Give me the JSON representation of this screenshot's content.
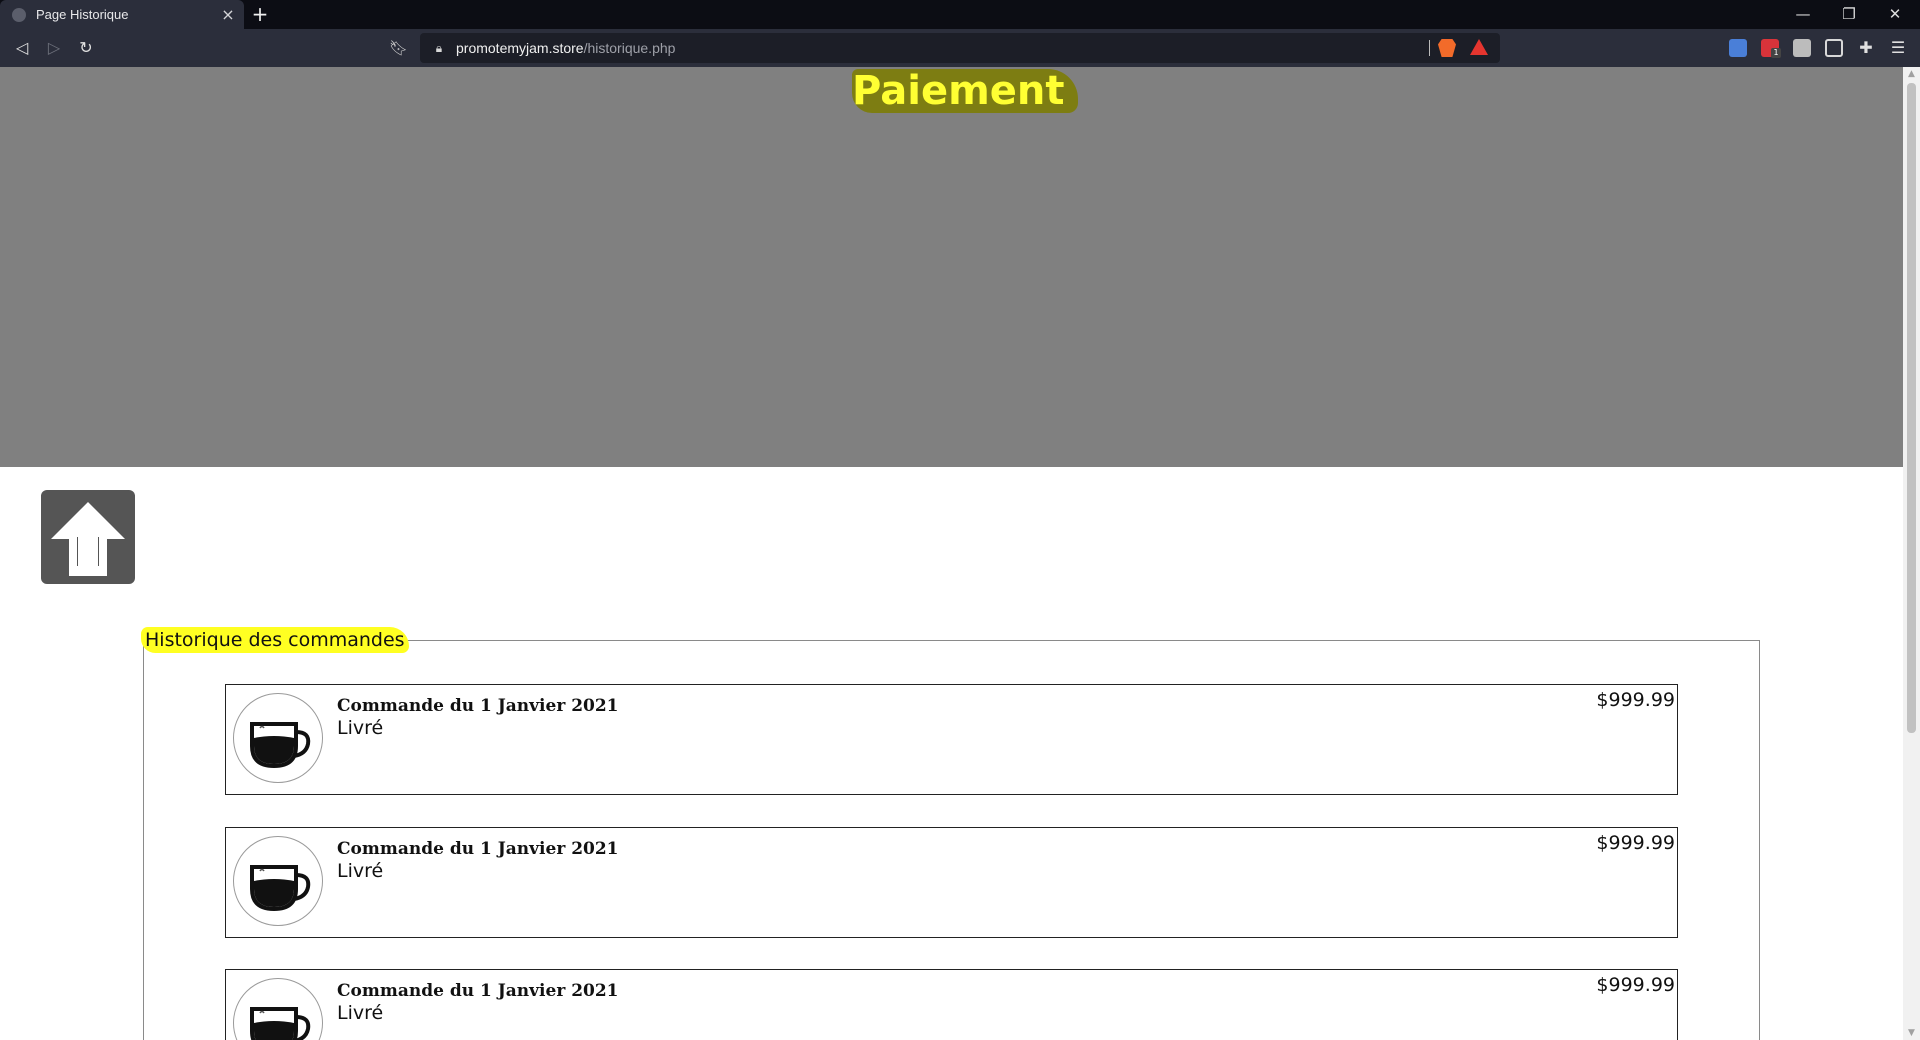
{
  "browser": {
    "tab_title": "Page Historique",
    "url_domain": "promotemyjam.store",
    "url_path": "/historique.php",
    "icons": {
      "tab_favicon": "globe-icon",
      "tab_close": "close-icon",
      "new_tab": "plus-icon",
      "minimize": "minimize-icon",
      "restore": "restore-icon",
      "close_window": "close-icon",
      "back": "back-icon",
      "forward": "forward-icon",
      "reload": "reload-icon",
      "bookmark": "bookmark-icon",
      "lock": "lock-icon",
      "shields": "brave-shields-icon",
      "rewards": "brave-rewards-icon",
      "extensions": "puzzle-icon",
      "menu": "menu-icon"
    },
    "extension_badge": "1"
  },
  "page": {
    "hero_title": "Paiement",
    "scroll_top_icon": "arrow-up-icon",
    "history_legend": "Historique des commandes",
    "orders": [
      {
        "title": "Commande du 1 Janvier 2021",
        "status": "Livré",
        "price": "$999.99",
        "icon": "coffee-cup-icon"
      },
      {
        "title": "Commande du 1 Janvier 2021",
        "status": "Livré",
        "price": "$999.99",
        "icon": "coffee-cup-icon"
      },
      {
        "title": "Commande du 1 Janvier 2021",
        "status": "Livré",
        "price": "$999.99",
        "icon": "coffee-cup-icon"
      }
    ]
  },
  "colors": {
    "hero_background": "#808080",
    "highlight": "#ffff22",
    "chrome_background": "#2b2e3b"
  }
}
